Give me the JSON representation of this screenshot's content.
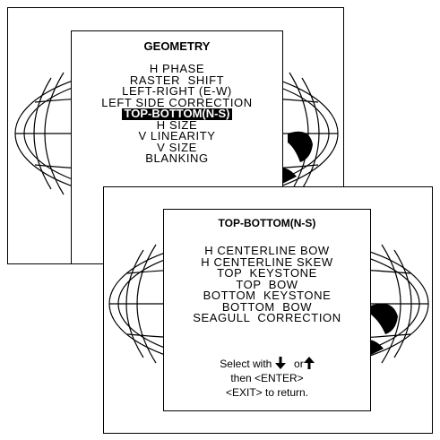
{
  "geometry_menu": {
    "title": "GEOMETRY",
    "items": [
      {
        "label": "H PHASE",
        "selected": false
      },
      {
        "label": "RASTER  SHIFT",
        "selected": false
      },
      {
        "label": "LEFT-RIGHT (E-W)",
        "selected": false
      },
      {
        "label": "LEFT SIDE CORRECTION",
        "selected": false
      },
      {
        "label": "TOP-BOTTOM(N-S)",
        "selected": true
      },
      {
        "label": "H SIZE",
        "selected": false
      },
      {
        "label": "V LINEARITY",
        "selected": false
      },
      {
        "label": "V SIZE",
        "selected": false
      },
      {
        "label": "BLANKING",
        "selected": false
      }
    ]
  },
  "top_bottom_menu": {
    "title": "TOP-BOTTOM(N-S)",
    "items": [
      {
        "label": "H CENTERLINE BOW"
      },
      {
        "label": "H CENTERLINE SKEW"
      },
      {
        "label": "TOP  KEYSTONE"
      },
      {
        "label": "TOP  BOW"
      },
      {
        "label": "BOTTOM  KEYSTONE"
      },
      {
        "label": "BOTTOM  BOW"
      },
      {
        "label": "SEAGULL  CORRECTION"
      }
    ],
    "help": {
      "select_prefix": "Select with",
      "select_or": "or",
      "down_icon": "arrow-down-icon",
      "up_icon": "arrow-up-icon",
      "enter_line": "then <ENTER>",
      "exit_line": "<EXIT> to return."
    }
  }
}
